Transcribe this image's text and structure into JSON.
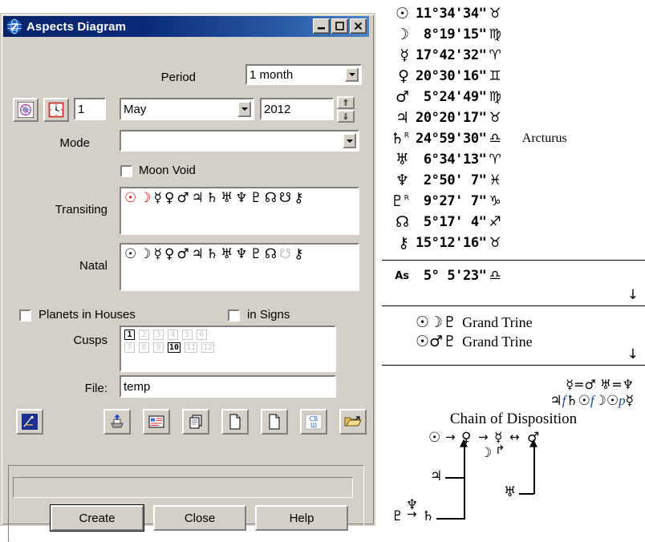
{
  "window": {
    "title": "Aspects Diagram",
    "icon": "globe-z-icon",
    "buttons": {
      "minimize": "minimize-icon",
      "maximize": "maximize-icon",
      "close": "close-icon"
    }
  },
  "form": {
    "period_label": "Period",
    "period_value": "1 month",
    "chart_wheel_button": "chart-wheel-icon",
    "clock_button": "clock-icon",
    "day_value": "1",
    "month_value": "May",
    "year_value": "2012",
    "spin_up": "⇑",
    "spin_down": "⇓",
    "mode_label": "Mode",
    "mode_value": "",
    "moon_void_label": "Moon Void",
    "moon_void_checked": false,
    "transiting_label": "Transiting",
    "natal_label": "Natal",
    "planets_in_houses_label": "Planets in Houses",
    "planets_in_houses_checked": false,
    "in_signs_label": "in Signs",
    "in_signs_checked": false,
    "cusps_label": "Cusps",
    "file_label": "File:",
    "file_value": "temp",
    "status_text": ""
  },
  "transiting_planets": [
    {
      "glyph": "☉",
      "name": "sun",
      "color": "red"
    },
    {
      "glyph": "☽",
      "name": "moon",
      "color": "red"
    },
    {
      "glyph": "☿",
      "name": "mercury",
      "color": "black"
    },
    {
      "glyph": "♀",
      "name": "venus",
      "color": "black"
    },
    {
      "glyph": "♂",
      "name": "mars",
      "color": "black"
    },
    {
      "glyph": "♃",
      "name": "jupiter",
      "color": "black"
    },
    {
      "glyph": "♄",
      "name": "saturn",
      "color": "black"
    },
    {
      "glyph": "♅",
      "name": "uranus",
      "color": "black"
    },
    {
      "glyph": "♆",
      "name": "neptune",
      "color": "black"
    },
    {
      "glyph": "♇",
      "name": "pluto",
      "color": "black"
    },
    {
      "glyph": "☊",
      "name": "north-node",
      "color": "black"
    },
    {
      "glyph": "☋",
      "name": "south-node",
      "color": "black"
    },
    {
      "glyph": "⚷",
      "name": "chiron",
      "color": "black"
    }
  ],
  "natal_planets": [
    {
      "glyph": "☉",
      "name": "sun",
      "color": "black"
    },
    {
      "glyph": "☽",
      "name": "moon",
      "color": "black"
    },
    {
      "glyph": "☿",
      "name": "mercury",
      "color": "black"
    },
    {
      "glyph": "♀",
      "name": "venus",
      "color": "black"
    },
    {
      "glyph": "♂",
      "name": "mars",
      "color": "black"
    },
    {
      "glyph": "♃",
      "name": "jupiter",
      "color": "black"
    },
    {
      "glyph": "♄",
      "name": "saturn",
      "color": "black"
    },
    {
      "glyph": "♅",
      "name": "uranus",
      "color": "black"
    },
    {
      "glyph": "♆",
      "name": "neptune",
      "color": "black"
    },
    {
      "glyph": "♇",
      "name": "pluto",
      "color": "black"
    },
    {
      "glyph": "☊",
      "name": "north-node",
      "color": "black"
    },
    {
      "glyph": "☋",
      "name": "south-node",
      "color": "gray"
    },
    {
      "glyph": "⚷",
      "name": "chiron",
      "color": "black"
    }
  ],
  "cusps": {
    "row1": [
      {
        "label": "1",
        "selected": true
      },
      {
        "label": "2",
        "selected": false
      },
      {
        "label": "3",
        "selected": false
      },
      {
        "label": "4",
        "selected": false
      },
      {
        "label": "5",
        "selected": false
      },
      {
        "label": "6",
        "selected": false
      }
    ],
    "row2": [
      {
        "label": "7",
        "selected": false
      },
      {
        "label": "8",
        "selected": false
      },
      {
        "label": "9",
        "selected": false
      },
      {
        "label": "10",
        "selected": true
      },
      {
        "label": "11",
        "selected": false
      },
      {
        "label": "12",
        "selected": false
      }
    ]
  },
  "toolbar": [
    {
      "name": "aspects-diagram-icon"
    },
    {
      "name": "print-icon"
    },
    {
      "name": "report-icon"
    },
    {
      "name": "copy-icon"
    },
    {
      "name": "new-document-icon"
    },
    {
      "name": "new-document-2-icon"
    },
    {
      "name": "cbsh-icon",
      "label": "СВШ"
    },
    {
      "name": "open-folder-icon"
    }
  ],
  "dialog_buttons": {
    "create": "Create",
    "close": "Close",
    "help": "Help"
  },
  "positions": [
    {
      "planet": "sun",
      "glyph": "☉",
      "retro": "",
      "deg": "11°",
      "min": "34'",
      "sec": "34\"",
      "sign": "♉",
      "sign_name": "taurus",
      "note": ""
    },
    {
      "planet": "moon",
      "glyph": "☽",
      "retro": "",
      "deg": " 8°",
      "min": "19'",
      "sec": "15\"",
      "sign": "♍",
      "sign_name": "virgo",
      "note": ""
    },
    {
      "planet": "mercury",
      "glyph": "☿",
      "retro": "",
      "deg": "17°",
      "min": "42'",
      "sec": "32\"",
      "sign": "♈",
      "sign_name": "aries",
      "note": ""
    },
    {
      "planet": "venus",
      "glyph": "♀",
      "retro": "",
      "deg": "20°",
      "min": "30'",
      "sec": "16\"",
      "sign": "♊",
      "sign_name": "gemini",
      "note": ""
    },
    {
      "planet": "mars",
      "glyph": "♂",
      "retro": "",
      "deg": " 5°",
      "min": "24'",
      "sec": "49\"",
      "sign": "♍",
      "sign_name": "virgo",
      "note": ""
    },
    {
      "planet": "jupiter",
      "glyph": "♃",
      "retro": "",
      "deg": "20°",
      "min": "20'",
      "sec": "17\"",
      "sign": "♉",
      "sign_name": "taurus",
      "note": ""
    },
    {
      "planet": "saturn",
      "glyph": "♄",
      "retro": "R",
      "deg": "24°",
      "min": "59'",
      "sec": "30\"",
      "sign": "♎",
      "sign_name": "libra",
      "note": "Arcturus"
    },
    {
      "planet": "uranus",
      "glyph": "♅",
      "retro": "",
      "deg": " 6°",
      "min": "34'",
      "sec": "13\"",
      "sign": "♈",
      "sign_name": "aries",
      "note": ""
    },
    {
      "planet": "neptune",
      "glyph": "♆",
      "retro": "",
      "deg": " 2°",
      "min": "50'",
      "sec": " 7\"",
      "sign": "♓",
      "sign_name": "pisces",
      "note": ""
    },
    {
      "planet": "pluto",
      "glyph": "♇",
      "retro": "R",
      "deg": " 9°",
      "min": "27'",
      "sec": " 7\"",
      "sign": "♑",
      "sign_name": "capricorn",
      "note": ""
    },
    {
      "planet": "north-node",
      "glyph": "☊",
      "retro": "",
      "deg": " 5°",
      "min": "17'",
      "sec": " 4\"",
      "sign": "♐",
      "sign_name": "sagittarius",
      "note": ""
    },
    {
      "planet": "chiron",
      "glyph": "⚷",
      "retro": "",
      "deg": "15°",
      "min": "12'",
      "sec": "16\"",
      "sign": "♉",
      "sign_name": "taurus",
      "note": ""
    }
  ],
  "ascendant": {
    "label": "As",
    "deg": " 5°",
    "min": " 5'",
    "sec": "23\"",
    "sign": "♎",
    "sign_name": "libra"
  },
  "aspect_patterns": [
    {
      "symbols": "☉☽♇",
      "name": "Grand Trine"
    },
    {
      "symbols": "☉♂♇",
      "name": "Grand Trine"
    }
  ],
  "arrow_down": "↓",
  "disposition": {
    "line1": "☿=♂ ♅=♆",
    "line2_parts": [
      {
        "text": "♃",
        "style": "sym"
      },
      {
        "text": "f",
        "style": "blue"
      },
      {
        "text": "♄☉",
        "style": "sym"
      },
      {
        "text": "f",
        "style": "blue"
      },
      {
        "text": "☽☉",
        "style": "sym"
      },
      {
        "text": "p",
        "style": "blue"
      },
      {
        "text": "☿",
        "style": "sym"
      }
    ],
    "title": "Chain of Disposition",
    "chain_nodes": [
      {
        "name": "sun",
        "glyph": "☉"
      },
      {
        "name": "venus",
        "glyph": "♀"
      },
      {
        "name": "mercury",
        "glyph": "☿"
      },
      {
        "name": "mars",
        "glyph": "♂"
      },
      {
        "name": "moon",
        "glyph": "☽"
      },
      {
        "name": "jupiter",
        "glyph": "♃"
      },
      {
        "name": "uranus",
        "glyph": "♅"
      },
      {
        "name": "neptune",
        "glyph": "♆"
      },
      {
        "name": "pluto",
        "glyph": "♇"
      },
      {
        "name": "saturn",
        "glyph": "♄"
      }
    ],
    "arrow_right": "→",
    "arrow_both": "↔",
    "arrow_hook": "↱"
  },
  "colors": {
    "titlebar_start": "#0a246a",
    "titlebar_end": "#4d85c7",
    "dialog_face": "#d4d0c8",
    "highlight_red": "#e00000",
    "disabled_gray": "#c0c0c0",
    "accent_blue": "#1a4b9c"
  }
}
